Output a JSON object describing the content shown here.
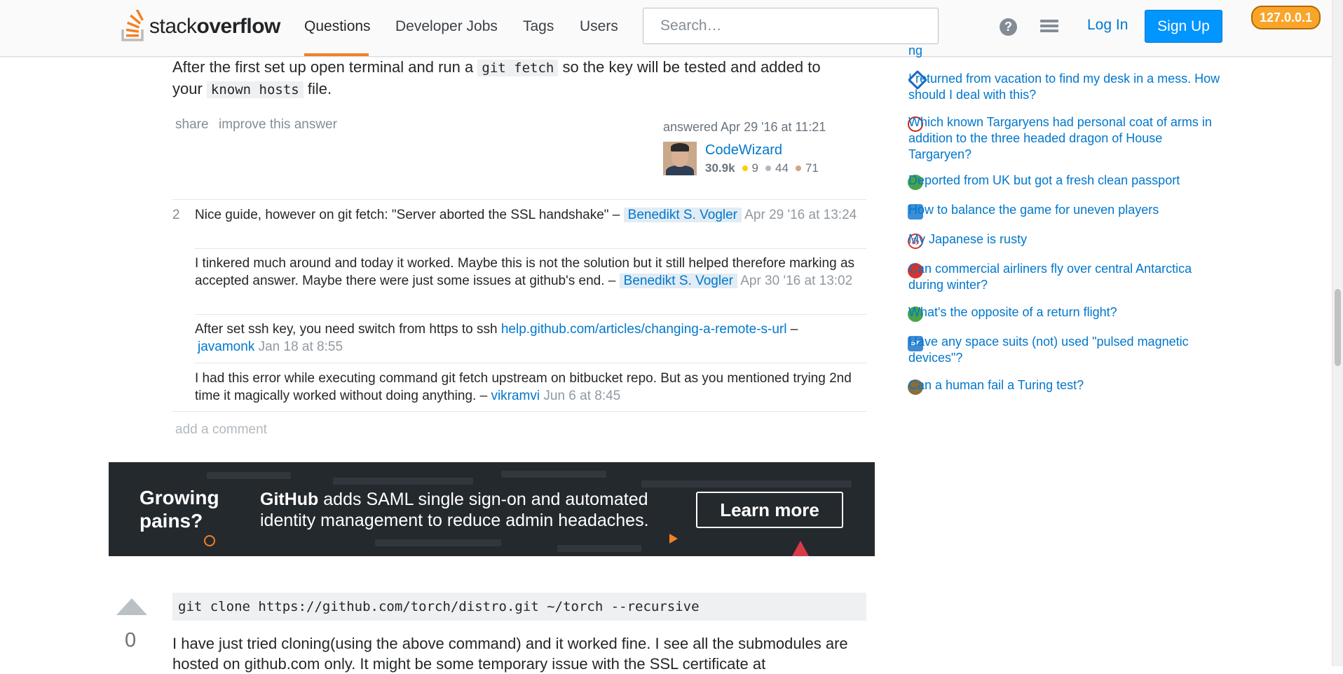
{
  "header": {
    "logo_text_light": "stack",
    "logo_text_bold": "overflow",
    "nav": [
      "Questions",
      "Developer Jobs",
      "Tags",
      "Users"
    ],
    "search_placeholder": "Search…",
    "login": "Log In",
    "signup": "Sign Up",
    "ip_badge": "127.0.0.1"
  },
  "answer": {
    "text_a": "After the first set up open terminal and run a",
    "code_a": "git fetch",
    "text_b": "so the key will be tested and added to",
    "text_c": "your",
    "code_b": "known hosts",
    "text_d": "file.",
    "share": "share",
    "improve": "improve this answer",
    "answered": "answered Apr 29 '16 at 11:21",
    "user": {
      "name": "CodeWizard",
      "rep": "30.9k",
      "gold": "9",
      "silver": "44",
      "bronze": "71"
    }
  },
  "comments": [
    {
      "score": "2",
      "text": "Nice guide, however on git fetch: \"Server aborted the SSL handshake\" –",
      "user": "Benedikt S. Vogler",
      "date": "Apr 29 '16 at 13:24"
    },
    {
      "score": "",
      "text": "I tinkered much around and today it worked. Maybe this is not the solution but it still helped therefore marking as accepted answer. Maybe there were just some issues at github's end. –",
      "user": "Benedikt S. Vogler",
      "date": "Apr 30 '16 at 13:02"
    },
    {
      "score": "",
      "text": "After set ssh key, you need switch from https to ssh",
      "link": "help.github.com/articles/changing-a-remote-s-url",
      "sep": "–",
      "user": "javamonk",
      "date": "Jan 18 at 8:55"
    },
    {
      "score": "",
      "text": "I had this error while executing command git fetch upstream on bitbucket repo. But as you mentioned trying 2nd time it magically worked without doing anything. –",
      "user": "vikramvi",
      "date": "Jun 6 at 8:45"
    }
  ],
  "add_comment": "add a comment",
  "ad": {
    "left_line1": "Growing",
    "left_line2": "pains?",
    "brand": "GitHub",
    "line1_rest": "adds SAML single sign-on and automated",
    "line2": "identity management to reduce admin headaches.",
    "button": "Learn more"
  },
  "next_answer": {
    "votes": "0",
    "code": "git clone https://github.com/torch/distro.git ~/torch --recursive",
    "text_line1": "I have just tried cloning(using the above command) and it worked fine. I see all the submodules are",
    "text_line2": "hosted on github.com only. It might be some temporary issue with the SSL certificate at"
  },
  "sidebar": {
    "hot_questions": [
      {
        "title": "I returned from vacation to find my desk in a mess. How should I deal with this?",
        "icon": "workplace-icon",
        "color": "#1f66c1"
      },
      {
        "title": "Which known Targaryens had personal coat of arms in addition to the three headed dragon of House Targaryen?",
        "icon": "scifi-icon",
        "color": "#c2281a"
      },
      {
        "title": "Deported from UK but got a fresh clean passport",
        "icon": "travel-icon",
        "color": "#49a447"
      },
      {
        "title": "How to balance the game for uneven players",
        "icon": "boardgames-icon",
        "color": "#3d8ed8"
      },
      {
        "title": "My Japanese is rusty",
        "icon": "japanese-icon",
        "color": "#d6362e"
      },
      {
        "title": "Can commercial airliners fly over central Antarctica during winter?",
        "icon": "aviation-icon",
        "color": "#d8322b"
      },
      {
        "title": "What's the opposite of a return flight?",
        "icon": "english-icon",
        "color": "#49a447"
      },
      {
        "title": "Have any space suits (not) used \"pulsed magnetic devices\"?",
        "icon": "space-icon",
        "color": "#3e8ad6"
      },
      {
        "title": "Can a human fail a Turing test?",
        "icon": "philosophy-icon",
        "color": "#8a6d3b"
      }
    ]
  },
  "colors": {
    "accent": "#f48024",
    "link": "#0077cc",
    "signup_bg": "#0095ff"
  }
}
